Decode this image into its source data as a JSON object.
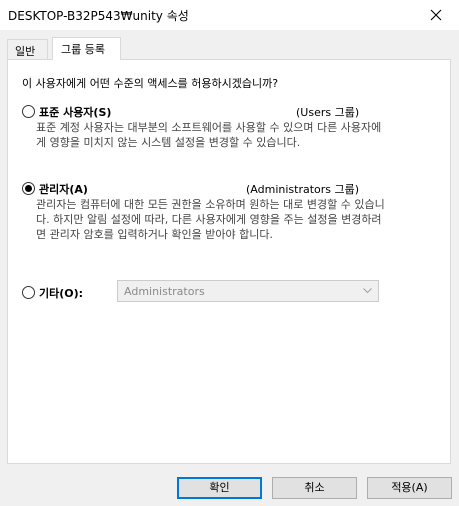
{
  "window": {
    "title": "DESKTOP-B32P543₩unity 속성"
  },
  "tabs": [
    {
      "label": "일반",
      "active": false
    },
    {
      "label": "그룹 등록",
      "active": true
    }
  ],
  "panel": {
    "question": "이 사용자에게 어떤 수준의 액세스를 허용하시겠습니까?",
    "options": [
      {
        "label": "표준 사용자(S)",
        "group": "(Users 그룹)",
        "selected": false,
        "description": "표준 계정 사용자는 대부분의 소프트웨어를 사용할 수 있으며 다른 사용자에게 영향을 미치지 않는 시스템 설정을 변경할 수 있습니다."
      },
      {
        "label": "관리자(A)",
        "group": "(Administrators 그룹)",
        "selected": true,
        "description": "관리자는 컴퓨터에 대한 모든 권한을 소유하며 원하는 대로 변경할 수 있습니다. 하지만 알림 설정에 따라, 다른 사용자에게 영향을 주는 설정을 변경하려면 관리자 암호를 입력하거나 확인을 받아야 합니다."
      },
      {
        "label": "기타(O):",
        "selected": false,
        "select_value": "Administrators",
        "select_disabled": true
      }
    ]
  },
  "buttons": {
    "ok": "확인",
    "cancel": "취소",
    "apply": "적용(A)"
  },
  "colors": {
    "dialog_bg": "#f0f0f0",
    "panel_bg": "#ffffff",
    "focus_border": "#0078d7",
    "disabled_text": "#8a8a8a"
  }
}
